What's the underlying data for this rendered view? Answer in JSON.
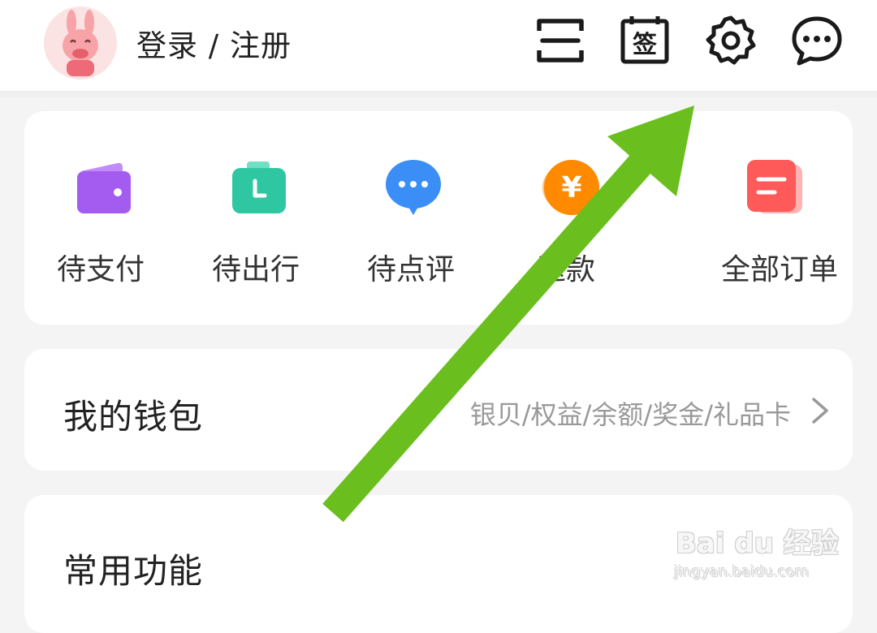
{
  "header": {
    "login_label": "登录 / 注册",
    "icons": [
      "scan-icon",
      "sign-in-icon",
      "settings-icon",
      "message-icon"
    ],
    "sign_glyph": "签"
  },
  "orders": {
    "items": [
      {
        "label": "待支付",
        "icon": "wallet-icon",
        "color": "#a45cf0"
      },
      {
        "label": "待出行",
        "icon": "briefcase-icon",
        "color": "#2fc7a2"
      },
      {
        "label": "待点评",
        "icon": "comment-icon",
        "color": "#3a8ef6"
      },
      {
        "label": "退款",
        "icon": "refund-icon",
        "color": "#ff8a00"
      },
      {
        "label": "全部订单",
        "icon": "order-list-icon",
        "color": "#ff5a5a"
      }
    ],
    "refund_glyph": "¥"
  },
  "wallet": {
    "title": "我的钱包",
    "subtitle": "银贝/权益/余额/奖金/礼品卡"
  },
  "common": {
    "title": "常用功能"
  },
  "overlay": {
    "arrow_color": "#6abf1e"
  },
  "watermark": {
    "brand": "Bai du 经验",
    "url": "jingyan.baidu.com"
  }
}
